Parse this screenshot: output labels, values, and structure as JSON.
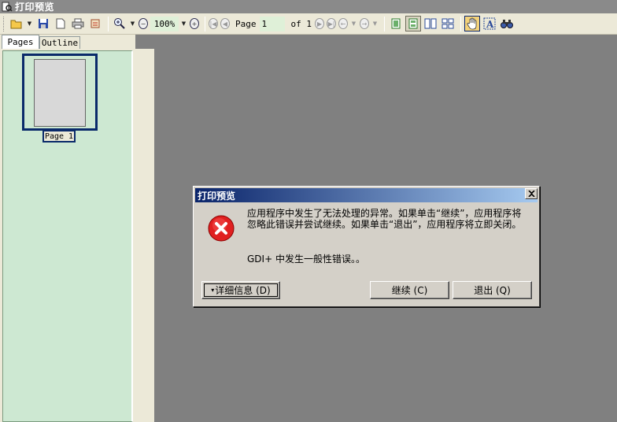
{
  "window": {
    "title": "打印预览"
  },
  "toolbar": {
    "zoom": "100%",
    "page_label": "Page",
    "page_value": "1",
    "of_label": "of 1"
  },
  "tabs": [
    {
      "label": "Pages"
    },
    {
      "label": "Outline"
    }
  ],
  "thumbnails": [
    {
      "label": "Page 1"
    }
  ],
  "dialog": {
    "title": "打印预览",
    "message": "应用程序中发生了无法处理的异常。如果单击“继续”，应用程序将忽略此错误并尝试继续。如果单击“退出”，应用程序将立即关闭。",
    "detail": "GDI+ 中发生一般性错误。。",
    "details_button": "详细信息 (D)",
    "continue_button": "继续 (C)",
    "quit_button": "退出 (Q)"
  },
  "colors": {
    "thumb_panel": "#cde8d2",
    "selection": "#0a2a6a",
    "preview_bg": "#808080",
    "error_red": "#e02020"
  }
}
